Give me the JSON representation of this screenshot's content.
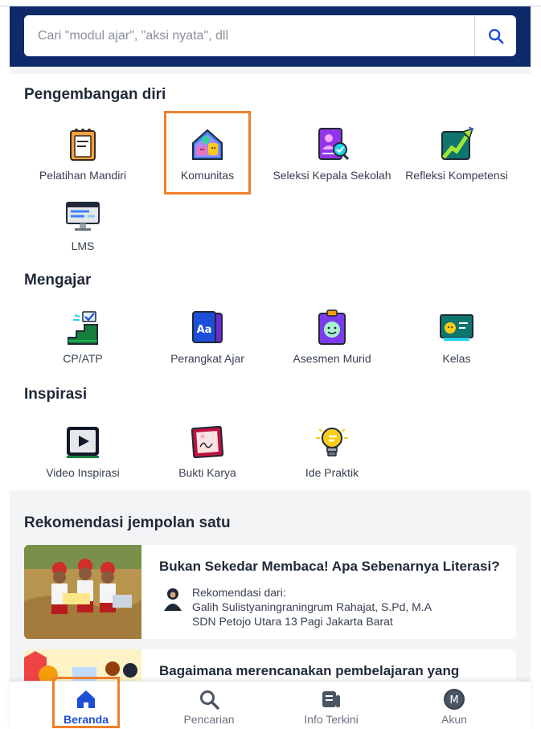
{
  "search": {
    "placeholder": "Cari \"modul ajar\", \"aksi nyata\", dll",
    "icon": "search-icon"
  },
  "sections": {
    "pengembangan": {
      "title": "Pengembangan diri",
      "items": [
        {
          "label": "Pelatihan Mandiri",
          "icon": "notebook-icon"
        },
        {
          "label": "Komunitas",
          "icon": "community-house-icon"
        },
        {
          "label": "Seleksi Kepala Sekolah",
          "icon": "profile-check-icon"
        },
        {
          "label": "Refleksi Kompetensi",
          "icon": "growth-chart-icon"
        },
        {
          "label": "LMS",
          "icon": "monitor-icon"
        }
      ]
    },
    "mengajar": {
      "title": "Mengajar",
      "items": [
        {
          "label": "CP/ATP",
          "icon": "stairs-check-icon"
        },
        {
          "label": "Perangkat Ajar",
          "icon": "book-aa-icon"
        },
        {
          "label": "Asesmen Murid",
          "icon": "clipboard-face-icon"
        },
        {
          "label": "Kelas",
          "icon": "blackboard-icon"
        }
      ]
    },
    "inspirasi": {
      "title": "Inspirasi",
      "items": [
        {
          "label": "Video Inspirasi",
          "icon": "video-play-icon"
        },
        {
          "label": "Bukti Karya",
          "icon": "framed-picture-icon"
        },
        {
          "label": "Ide Praktik",
          "icon": "lightbulb-icon"
        }
      ]
    }
  },
  "recommendation": {
    "title": "Rekomendasi jempolan satu",
    "cards": [
      {
        "title": "Bukan Sekedar Membaca! Apa Sebenarnya Literasi?",
        "from_label": "Rekomendasi dari:",
        "author": "Galih Sulistyaningraningrum Rahajat, S.Pd, M.A",
        "school": "SDN Petojo Utara 13 Pagi Jakarta Barat"
      },
      {
        "title": "Bagaimana merencanakan pembelajaran yang"
      }
    ]
  },
  "bottom_nav": [
    {
      "label": "Beranda",
      "icon": "home-icon",
      "active": true
    },
    {
      "label": "Pencarian",
      "icon": "search-icon",
      "active": false
    },
    {
      "label": "Info Terkini",
      "icon": "news-icon",
      "active": false
    },
    {
      "label": "Akun",
      "icon": "avatar-icon",
      "avatar_letter": "M",
      "active": false
    }
  ],
  "colors": {
    "brand_navy": "#0f2a6b",
    "highlight": "#f07f2c",
    "active_blue": "#1d4ed8"
  }
}
